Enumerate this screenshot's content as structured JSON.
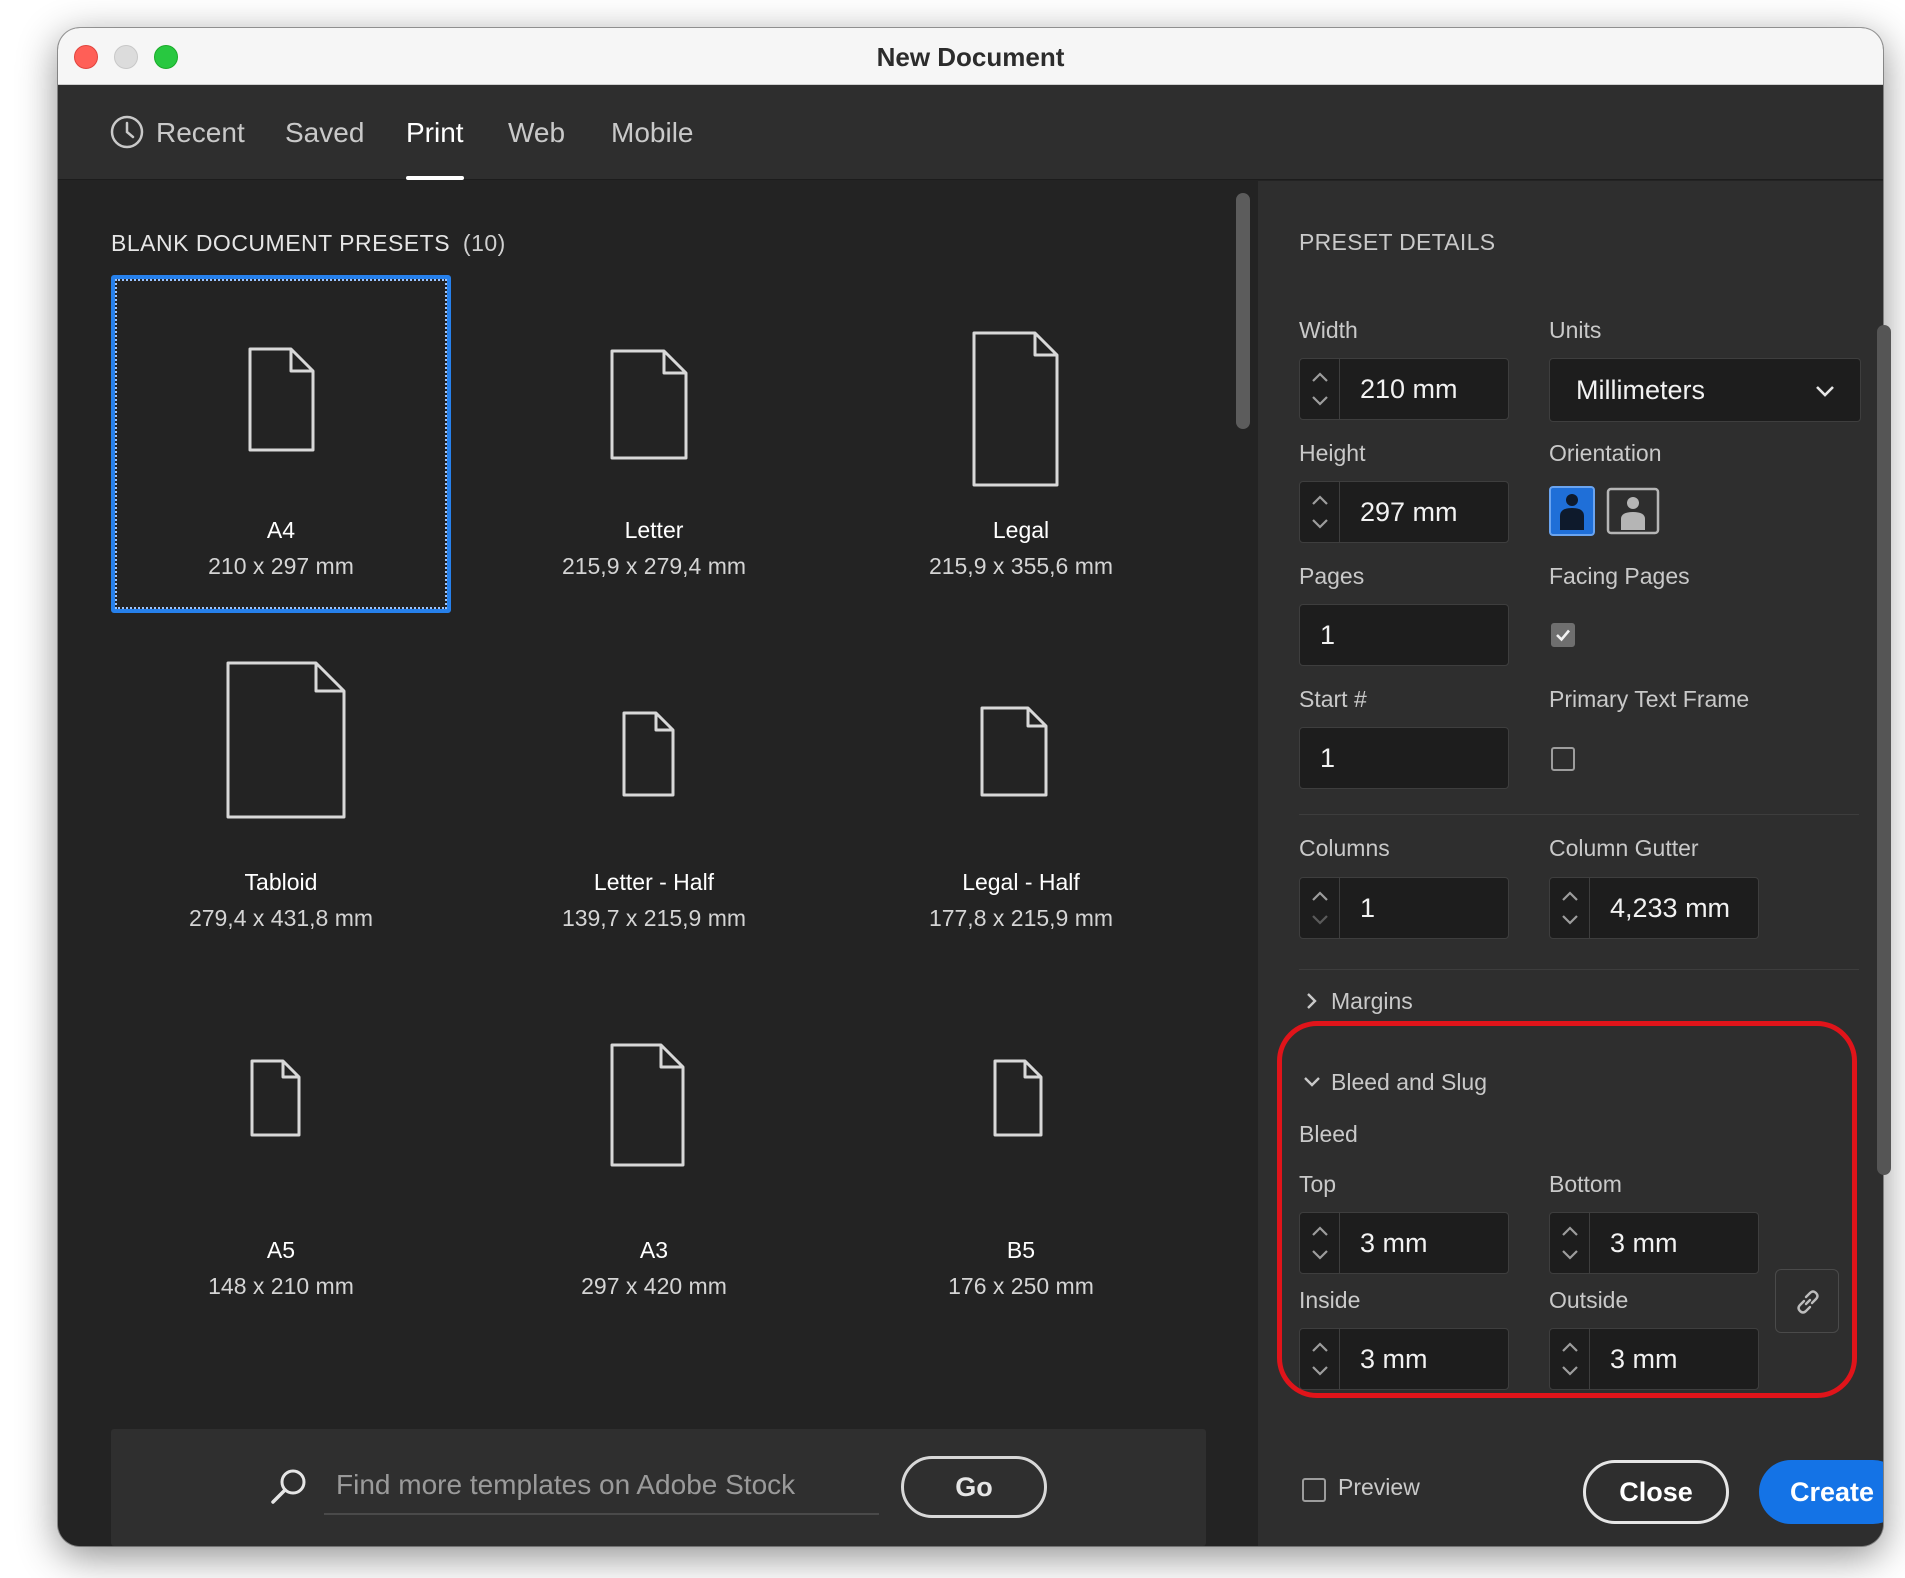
{
  "window": {
    "title": "New Document"
  },
  "tabs": [
    {
      "label": "Recent",
      "icon": "clock-icon"
    },
    {
      "label": "Saved"
    },
    {
      "label": "Print",
      "active": true
    },
    {
      "label": "Web"
    },
    {
      "label": "Mobile"
    }
  ],
  "presets": {
    "title": "BLANK DOCUMENT PRESETS",
    "count": "(10)",
    "items": [
      {
        "name": "A4",
        "size": "210 x 297 mm",
        "selected": true
      },
      {
        "name": "Letter",
        "size": "215,9 x 279,4 mm"
      },
      {
        "name": "Legal",
        "size": "215,9 x 355,6 mm"
      },
      {
        "name": "Tabloid",
        "size": "279,4 x 431,8 mm"
      },
      {
        "name": "Letter - Half",
        "size": "139,7 x 215,9 mm"
      },
      {
        "name": "Legal - Half",
        "size": "177,8 x 215,9 mm"
      },
      {
        "name": "A5",
        "size": "148 x 210 mm"
      },
      {
        "name": "A3",
        "size": "297 x 420 mm"
      },
      {
        "name": "B5",
        "size": "176 x 250 mm"
      }
    ]
  },
  "stock": {
    "placeholder": "Find more templates on Adobe Stock",
    "go_label": "Go"
  },
  "details": {
    "heading": "PRESET DETAILS",
    "width_label": "Width",
    "width_value": "210 mm",
    "units_label": "Units",
    "units_value": "Millimeters",
    "height_label": "Height",
    "height_value": "297 mm",
    "orientation_label": "Orientation",
    "pages_label": "Pages",
    "pages_value": "1",
    "facing_pages_label": "Facing Pages",
    "facing_pages_checked": true,
    "start_label": "Start #",
    "start_value": "1",
    "primary_text_frame_label": "Primary Text Frame",
    "primary_text_frame_checked": false,
    "columns_label": "Columns",
    "columns_value": "1",
    "gutter_label": "Column Gutter",
    "gutter_value": "4,233 mm",
    "margins_label": "Margins",
    "bleed_slug_label": "Bleed and Slug",
    "bleed_label": "Bleed",
    "top_label": "Top",
    "top_value": "3 mm",
    "bottom_label": "Bottom",
    "bottom_value": "3 mm",
    "inside_label": "Inside",
    "inside_value": "3 mm",
    "outside_label": "Outside",
    "outside_value": "3 mm"
  },
  "footer": {
    "preview_label": "Preview",
    "preview_checked": false,
    "close_label": "Close",
    "create_label": "Create"
  },
  "colors": {
    "accent": "#2680eb",
    "create_button": "#1473e6",
    "highlight": "#e0141a"
  }
}
